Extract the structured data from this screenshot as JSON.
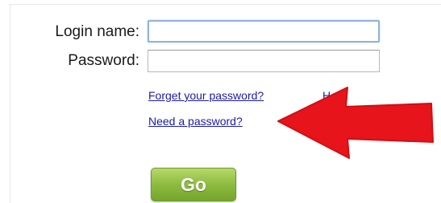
{
  "form": {
    "login_label": "Login name:",
    "login_value": "",
    "password_label": "Password:",
    "password_value": ""
  },
  "links": {
    "forgot_password": "Forget your password?",
    "help": "Help",
    "need_password": "Need a password?"
  },
  "buttons": {
    "go_label": "Go"
  },
  "annotation": {
    "arrow_icon": "red-arrow-left-icon",
    "arrow_color": "#e8141b"
  },
  "colors": {
    "link": "#1a1aa8",
    "go_button": "#8dbb3f",
    "focused_input_border": "#8eb2e2"
  }
}
